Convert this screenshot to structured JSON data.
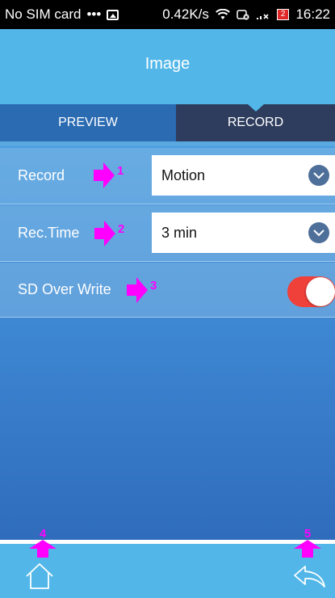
{
  "status_bar": {
    "carrier": "No SIM card",
    "dots": "•••",
    "speed": "0.42K/s",
    "battery": "2",
    "time": "16:22"
  },
  "header": {
    "title": "Image"
  },
  "tabs": [
    {
      "label": "PREVIEW",
      "active": false
    },
    {
      "label": "RECORD",
      "active": true
    }
  ],
  "settings": {
    "record": {
      "label": "Record",
      "value": "Motion",
      "marker": "1"
    },
    "rec_time": {
      "label": "Rec.Time",
      "value": "3 min",
      "marker": "2"
    },
    "sd_over_write": {
      "label": "SD Over Write",
      "enabled": true,
      "marker": "3"
    }
  },
  "bottom_bar": {
    "home_marker": "4",
    "back_marker": "5"
  },
  "colors": {
    "header": "#52b7e8",
    "tab_inactive": "#2a6bb2",
    "tab_active": "#2e3d5e",
    "toggle_on": "#f0403a",
    "marker": "#ff00ff"
  },
  "icons": {
    "status_image": "image-icon",
    "status_wifi": "wifi-icon",
    "status_signal": "signal-icon",
    "dropdown": "chevron-down-icon",
    "home": "home-icon",
    "back": "back-arrow-icon",
    "marker_right": "arrow-right-icon",
    "marker_up": "arrow-up-icon"
  }
}
